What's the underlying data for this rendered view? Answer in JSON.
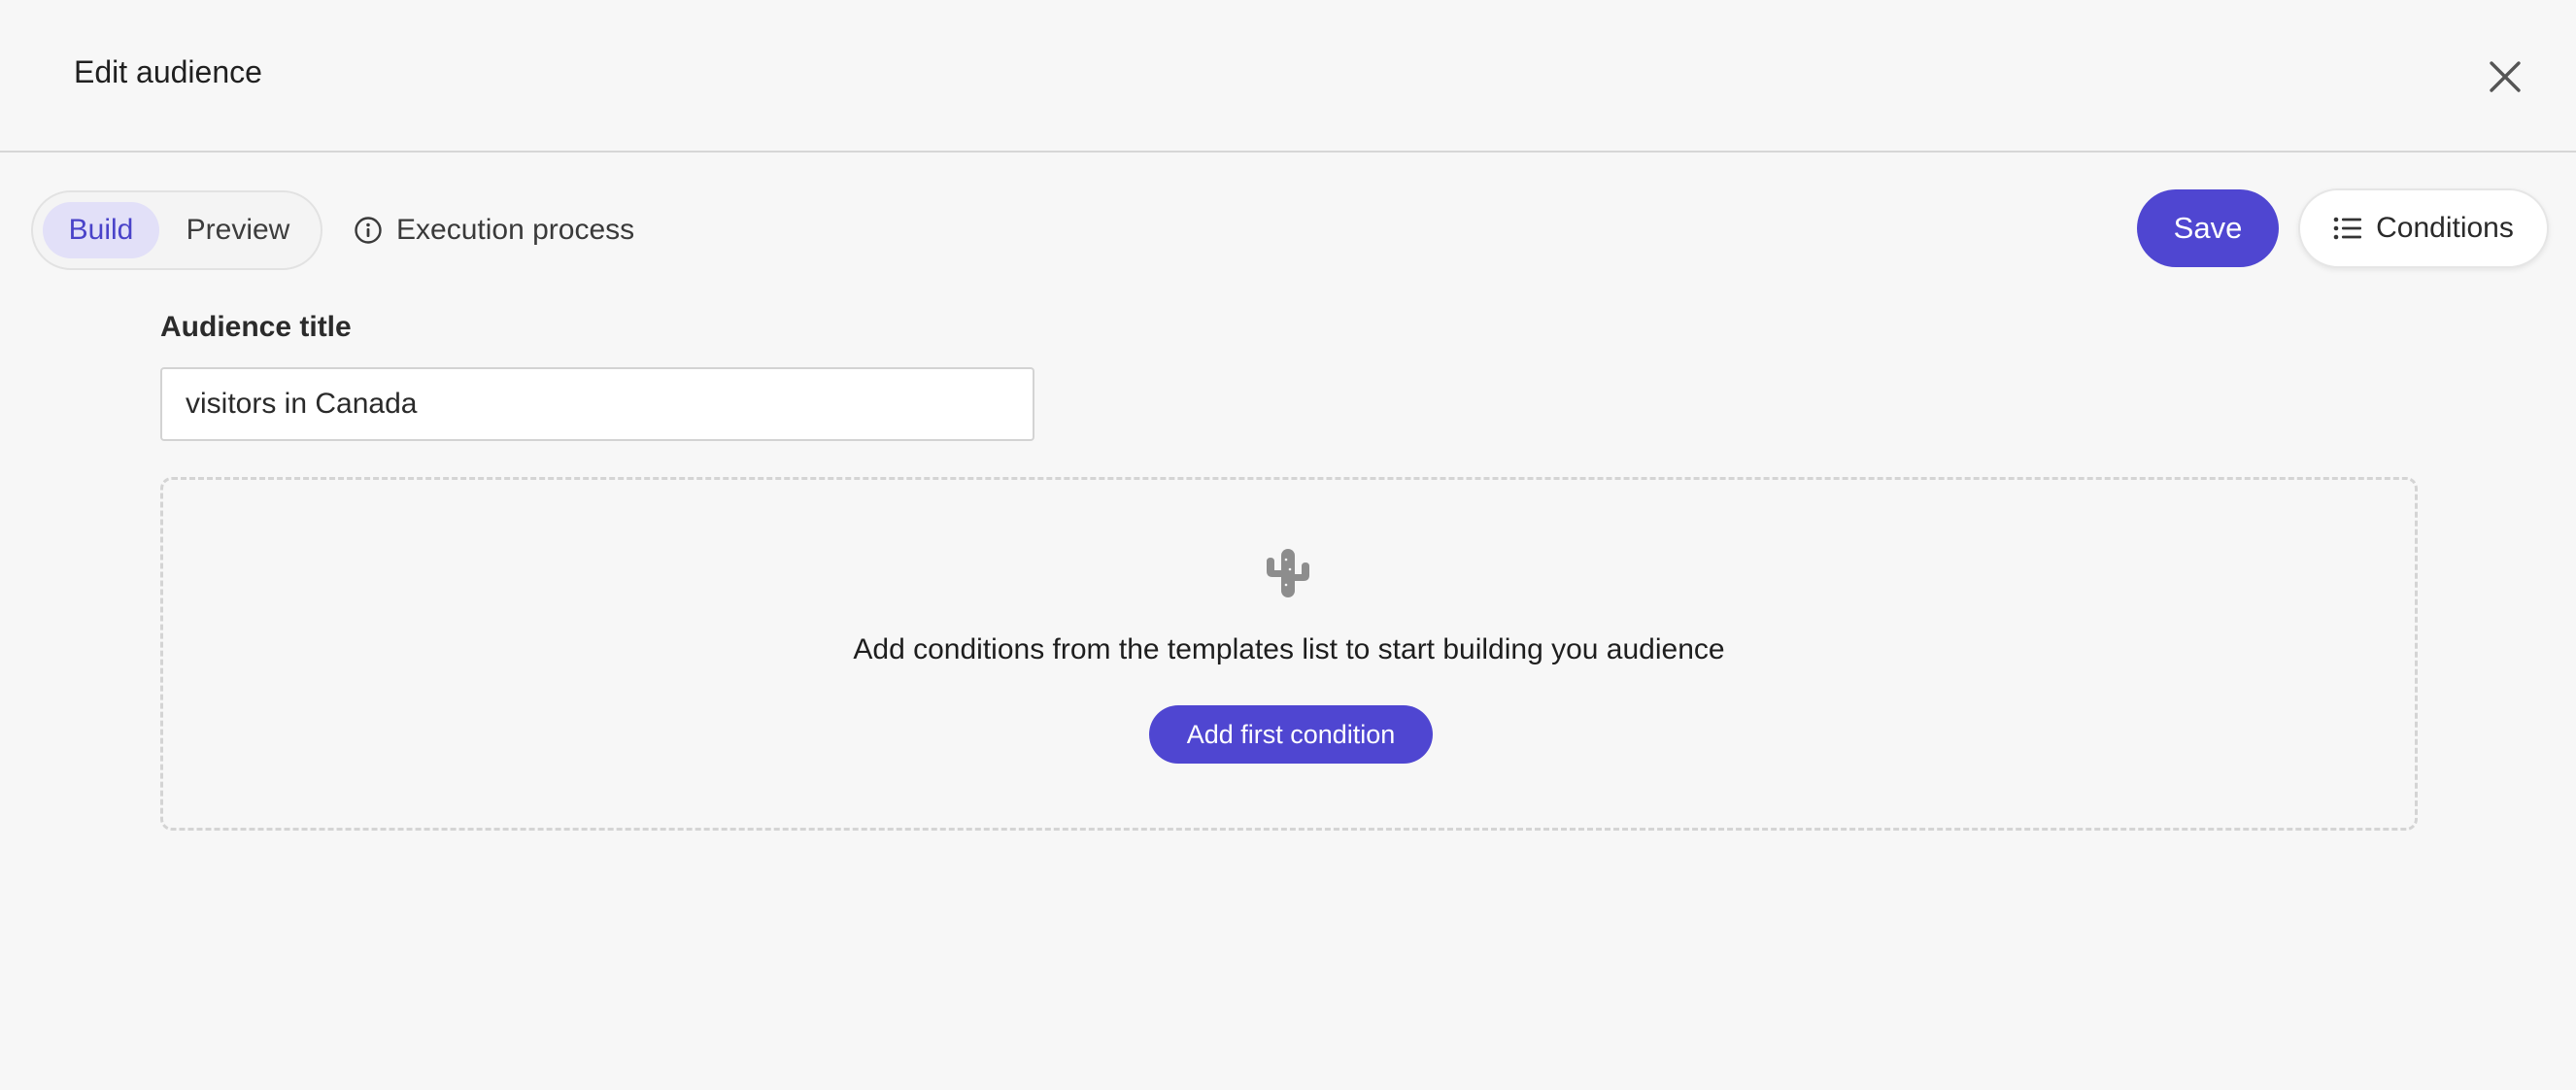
{
  "header": {
    "title": "Edit audience",
    "close_icon": "close-icon"
  },
  "toolbar": {
    "tabs": [
      {
        "label": "Build",
        "active": true
      },
      {
        "label": "Preview",
        "active": false
      }
    ],
    "execution": {
      "label": "Execution process",
      "icon": "info-icon"
    },
    "save_label": "Save",
    "conditions": {
      "label": "Conditions",
      "icon": "list-icon"
    }
  },
  "form": {
    "title_label": "Audience title",
    "title_value": "visitors in Canada"
  },
  "empty_state": {
    "icon": "cactus-icon",
    "message": "Add conditions from the templates list to start building you audience",
    "button_label": "Add first condition"
  },
  "colors": {
    "accent": "#4f46d1",
    "active_tab_bg": "#e2e0f8",
    "background": "#f7f7f7"
  }
}
